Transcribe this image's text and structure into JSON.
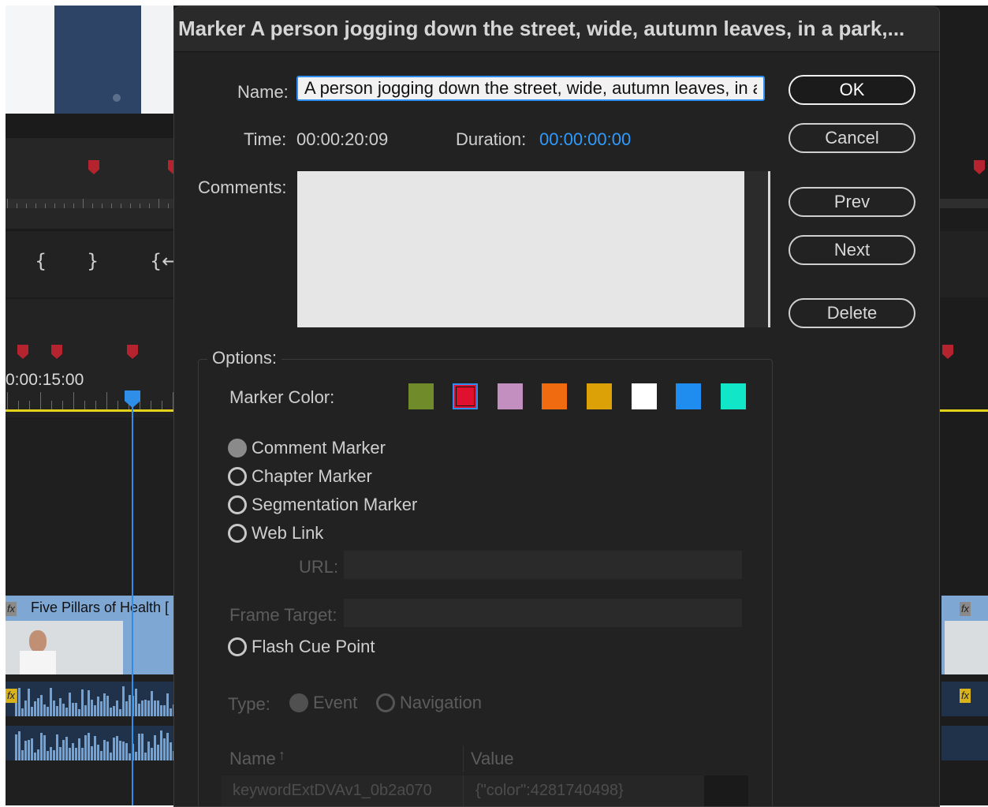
{
  "dialog": {
    "title": "Marker A person jogging down the street, wide, autumn leaves, in a park,...",
    "name_label": "Name:",
    "name_value": "A person jogging down the street, wide, autumn leaves, in a",
    "time_label": "Time:",
    "time_value": "00:00:20:09",
    "duration_label": "Duration:",
    "duration_value": "00:00:00:00",
    "comments_label": "Comments:",
    "comments_value": "",
    "buttons": {
      "ok": "OK",
      "cancel": "Cancel",
      "prev": "Prev",
      "next": "Next",
      "delete": "Delete"
    },
    "options_label": "Options:",
    "marker_color_label": "Marker Color:",
    "marker_colors": [
      "#6f8b2a",
      "#e0102f",
      "#c38ec0",
      "#f06a0f",
      "#dca107",
      "#ffffff",
      "#1f8cf0",
      "#12e6c8"
    ],
    "selected_color": "#e0102f",
    "marker_types": [
      "Comment Marker",
      "Chapter Marker",
      "Segmentation Marker",
      "Web Link"
    ],
    "selected_type": "Comment Marker",
    "url_label": "URL:",
    "frame_target_label": "Frame Target:",
    "flash_cue_label": "Flash Cue Point",
    "type_label": "Type:",
    "type_options": [
      "Event",
      "Navigation"
    ],
    "table": {
      "name_header": "Name",
      "value_header": "Value",
      "rows": [
        {
          "name": "keywordExtDVAv1_0b2a070",
          "value": "{\"color\":4281740498}"
        }
      ]
    }
  },
  "background": {
    "timecode": "0:00:15:00",
    "clip_title": "Five Pillars of Health [",
    "fx_label": "fx"
  }
}
